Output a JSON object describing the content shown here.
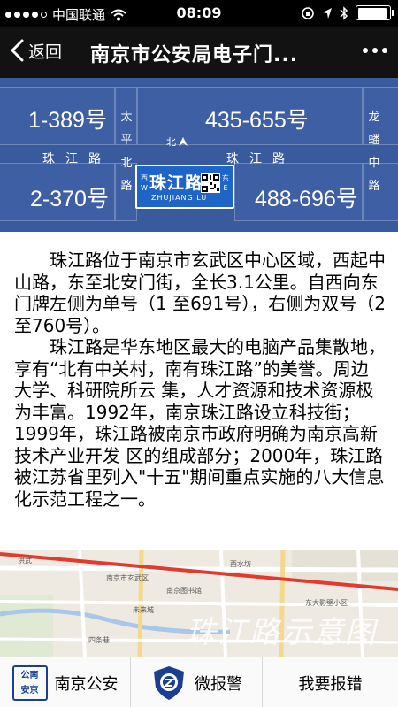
{
  "status_bar": {
    "carrier": "中国联通",
    "time": "08:09",
    "signal_bars": 4,
    "battery_fraction": 0.92
  },
  "nav": {
    "back_label": "返回",
    "title": "南京市公安局电子门..."
  },
  "sign": {
    "top_left_range": "1-389号",
    "top_right_range": "435-655号",
    "bottom_left_range": "2-370号",
    "bottom_right_range": "488-696号",
    "road_name_left": "珠江路",
    "road_name_right": "珠江路",
    "cross_street_left": "太平北路",
    "cross_street_right": "龙蟠中路",
    "north_label": "北",
    "plate_name": "珠江路",
    "plate_pinyin": "ZHUJIANG LU",
    "plate_west": "西",
    "plate_west_letter": "W",
    "plate_east": "东",
    "plate_east_letter": "E"
  },
  "content": {
    "paragraphs": [
      "珠江路位于南京市玄武区中心区域，西起中山路，东至北安门街，全长3.1公里。自西向东门牌左侧为单号（1 至691号），右侧为双号（2至760号）。",
      "珠江路是华东地区最大的电脑产品集散地，享有“北有中关村，南有珠江路”的美誉。周边大学、科研院所云 集，人才资源和技术资源极为丰富。1992年，南京珠江路设立科技街；1999年，珠江路被南京市政府明确为南京高新技术产业开发 区的组成部分；2000年，珠江路被江苏省里列入\"十五\"期间重点实施的八大信息化示范工程之一。"
    ]
  },
  "map": {
    "labels": [
      "洪武",
      "南京市玄武区",
      "南京图书馆",
      "东大影壁小区",
      "未来城",
      "四条巷",
      "西水坊"
    ],
    "watermark": "珠江路示意图",
    "road_color": "#e23a2f"
  },
  "tabs": [
    {
      "label": "南京公安",
      "logo_top": "公南",
      "logo_bottom": "安京"
    },
    {
      "label": "微报警"
    },
    {
      "label": "我要报错"
    }
  ],
  "colors": {
    "sign_blue": "#3e5fa3",
    "plate_blue": "#1f64c7",
    "police_blue": "#1a3f91"
  }
}
